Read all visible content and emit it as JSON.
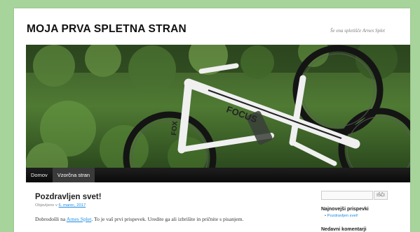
{
  "site": {
    "title": "MOJA PRVA SPLETNA STRAN",
    "tagline": "Še ena spletišče Arnes Splet"
  },
  "nav": {
    "items": [
      {
        "label": "Domov",
        "active": false
      },
      {
        "label": "Vzorčna stran",
        "active": true
      }
    ]
  },
  "post": {
    "title": "Pozdravljen svet!",
    "meta_prefix": "Objavljeno v",
    "date": "6. marec, 2017",
    "body_before_link": "Dobrodošli na ",
    "body_link": "Arnes Splet",
    "body_after_link": ". To je vaš prvi prispevek. Uredite ga ali izbrišite in pričnite s pisanjem."
  },
  "sidebar": {
    "search_placeholder": "",
    "search_button": "IŠČI",
    "recent_posts_title": "Najnovejši prispevki",
    "recent_posts": [
      "Pozdravljen svet!"
    ],
    "recent_comments_title": "Nedavni komentarji"
  },
  "colors": {
    "page_background": "#a6d49a",
    "link": "#1b8be0",
    "nav_background": "#111111"
  }
}
